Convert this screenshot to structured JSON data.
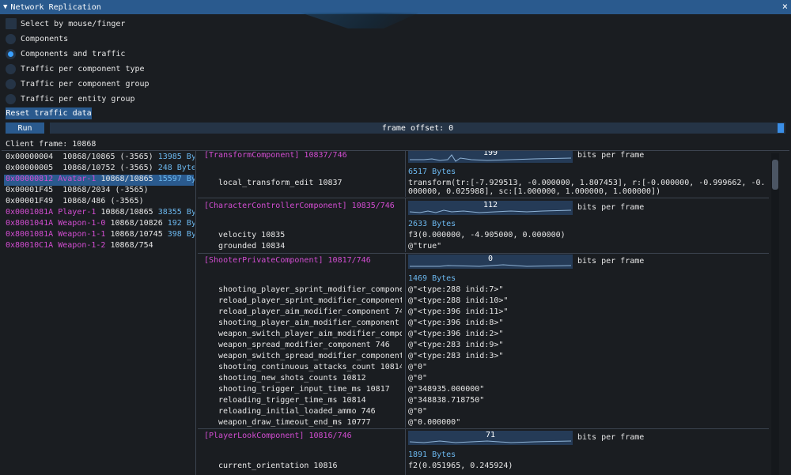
{
  "window": {
    "title": "Network Replication"
  },
  "options": {
    "select_mouse": "Select by mouse/finger",
    "radios": [
      {
        "label": "Components",
        "selected": false
      },
      {
        "label": "Components and traffic",
        "selected": true
      },
      {
        "label": "Traffic per component type",
        "selected": false
      },
      {
        "label": "Traffic per component group",
        "selected": false
      },
      {
        "label": "Traffic per entity group",
        "selected": false
      }
    ]
  },
  "buttons": {
    "reset": "Reset traffic data",
    "run": "Run"
  },
  "frame_offset": "frame offset: 0",
  "client_frame": "Client frame: 10868",
  "entities": [
    {
      "id": "0x00000004",
      "name": "",
      "info": "10868/10865 (-3565)",
      "bytes": "13985 By"
    },
    {
      "id": "0x00000005",
      "name": "",
      "info": "10868/10752 (-3565)",
      "bytes": "248 Byte"
    },
    {
      "id": "0x00000812",
      "name": "Avatar-1",
      "info": "10868/10865",
      "bytes": "15597 By"
    },
    {
      "id": "0x00001F45",
      "name": "",
      "info": "10868/2034 (-3565)",
      "bytes": ""
    },
    {
      "id": "0x00001F49",
      "name": "",
      "info": "10868/486 (-3565)",
      "bytes": ""
    },
    {
      "id": "0x0001081A",
      "name": "Player-1",
      "info": "10868/10865",
      "bytes": "38355 By"
    },
    {
      "id": "0x8001041A",
      "name": "Weapon-1-0",
      "info": "10868/10826",
      "bytes": "192 By"
    },
    {
      "id": "0x8001081A",
      "name": "Weapon-1-1",
      "info": "10868/10745",
      "bytes": "398 By"
    },
    {
      "id": "0x80010C1A",
      "name": "Weapon-1-2",
      "info": "10868/754",
      "bytes": ""
    }
  ],
  "bits_label": "bits per frame",
  "components": [
    {
      "header": "[TransformComponent] 10837/746",
      "bits": "199",
      "bytes": "6517 Bytes",
      "fields": [
        {
          "name": "local_transform_edit 10837",
          "value": "transform(tr:[-7.929513, -0.000000, 1.807453], r:[-0.000000, -0.999662, -0.",
          "value2": "000000, 0.025988], sc:[1.000000, 1.000000, 1.000000])"
        }
      ]
    },
    {
      "header": "[CharacterControllerComponent] 10835/746",
      "bits": "112",
      "bytes": "2633 Bytes",
      "fields": [
        {
          "name": "velocity 10835",
          "value": "f3(0.000000, -4.905000, 0.000000)"
        },
        {
          "name": "grounded 10834",
          "value": "@\"true\""
        }
      ]
    },
    {
      "header": "[ShooterPrivateComponent] 10817/746",
      "bits": "0",
      "bytes": "1469 Bytes",
      "fields": [
        {
          "name": "shooting_player_sprint_modifier_component 746",
          "value": "@\"<type:288 inid:7>\""
        },
        {
          "name": "reload_player_sprint_modifier_component 746",
          "value": "@\"<type:288 inid:10>\""
        },
        {
          "name": "reload_player_aim_modifier_component 746",
          "value": "@\"<type:396 inid:11>\""
        },
        {
          "name": "shooting_player_aim_modifier_component 746",
          "value": "@\"<type:396 inid:8>\""
        },
        {
          "name": "weapon_switch_player_aim_modifier_component 746",
          "value": "@\"<type:396 inid:2>\""
        },
        {
          "name": "weapon_spread_modifier_component 746",
          "value": "@\"<type:283 inid:9>\""
        },
        {
          "name": "weapon_switch_spread_modifier_component 746",
          "value": "@\"<type:283 inid:3>\""
        },
        {
          "name": "shooting_continuous_attacks_count 10814",
          "value": "@\"0\""
        },
        {
          "name": "shooting_new_shots_counts 10812",
          "value": "@\"0\""
        },
        {
          "name": "shooting_trigger_input_time_ms 10817",
          "value": "@\"348935.000000\""
        },
        {
          "name": "reloading_trigger_time_ms 10814",
          "value": "@\"348838.718750\""
        },
        {
          "name": "reloading_initial_loaded_ammo 746",
          "value": "@\"0\""
        },
        {
          "name": "weapon_draw_timeout_end_ms 10777",
          "value": "@\"0.000000\""
        }
      ]
    },
    {
      "header": "[PlayerLookComponent] 10816/746",
      "bits": "71",
      "bytes": "1891 Bytes",
      "fields": [
        {
          "name": "current_orientation 10816",
          "value": "f2(0.051965, 0.245924)"
        }
      ]
    }
  ]
}
